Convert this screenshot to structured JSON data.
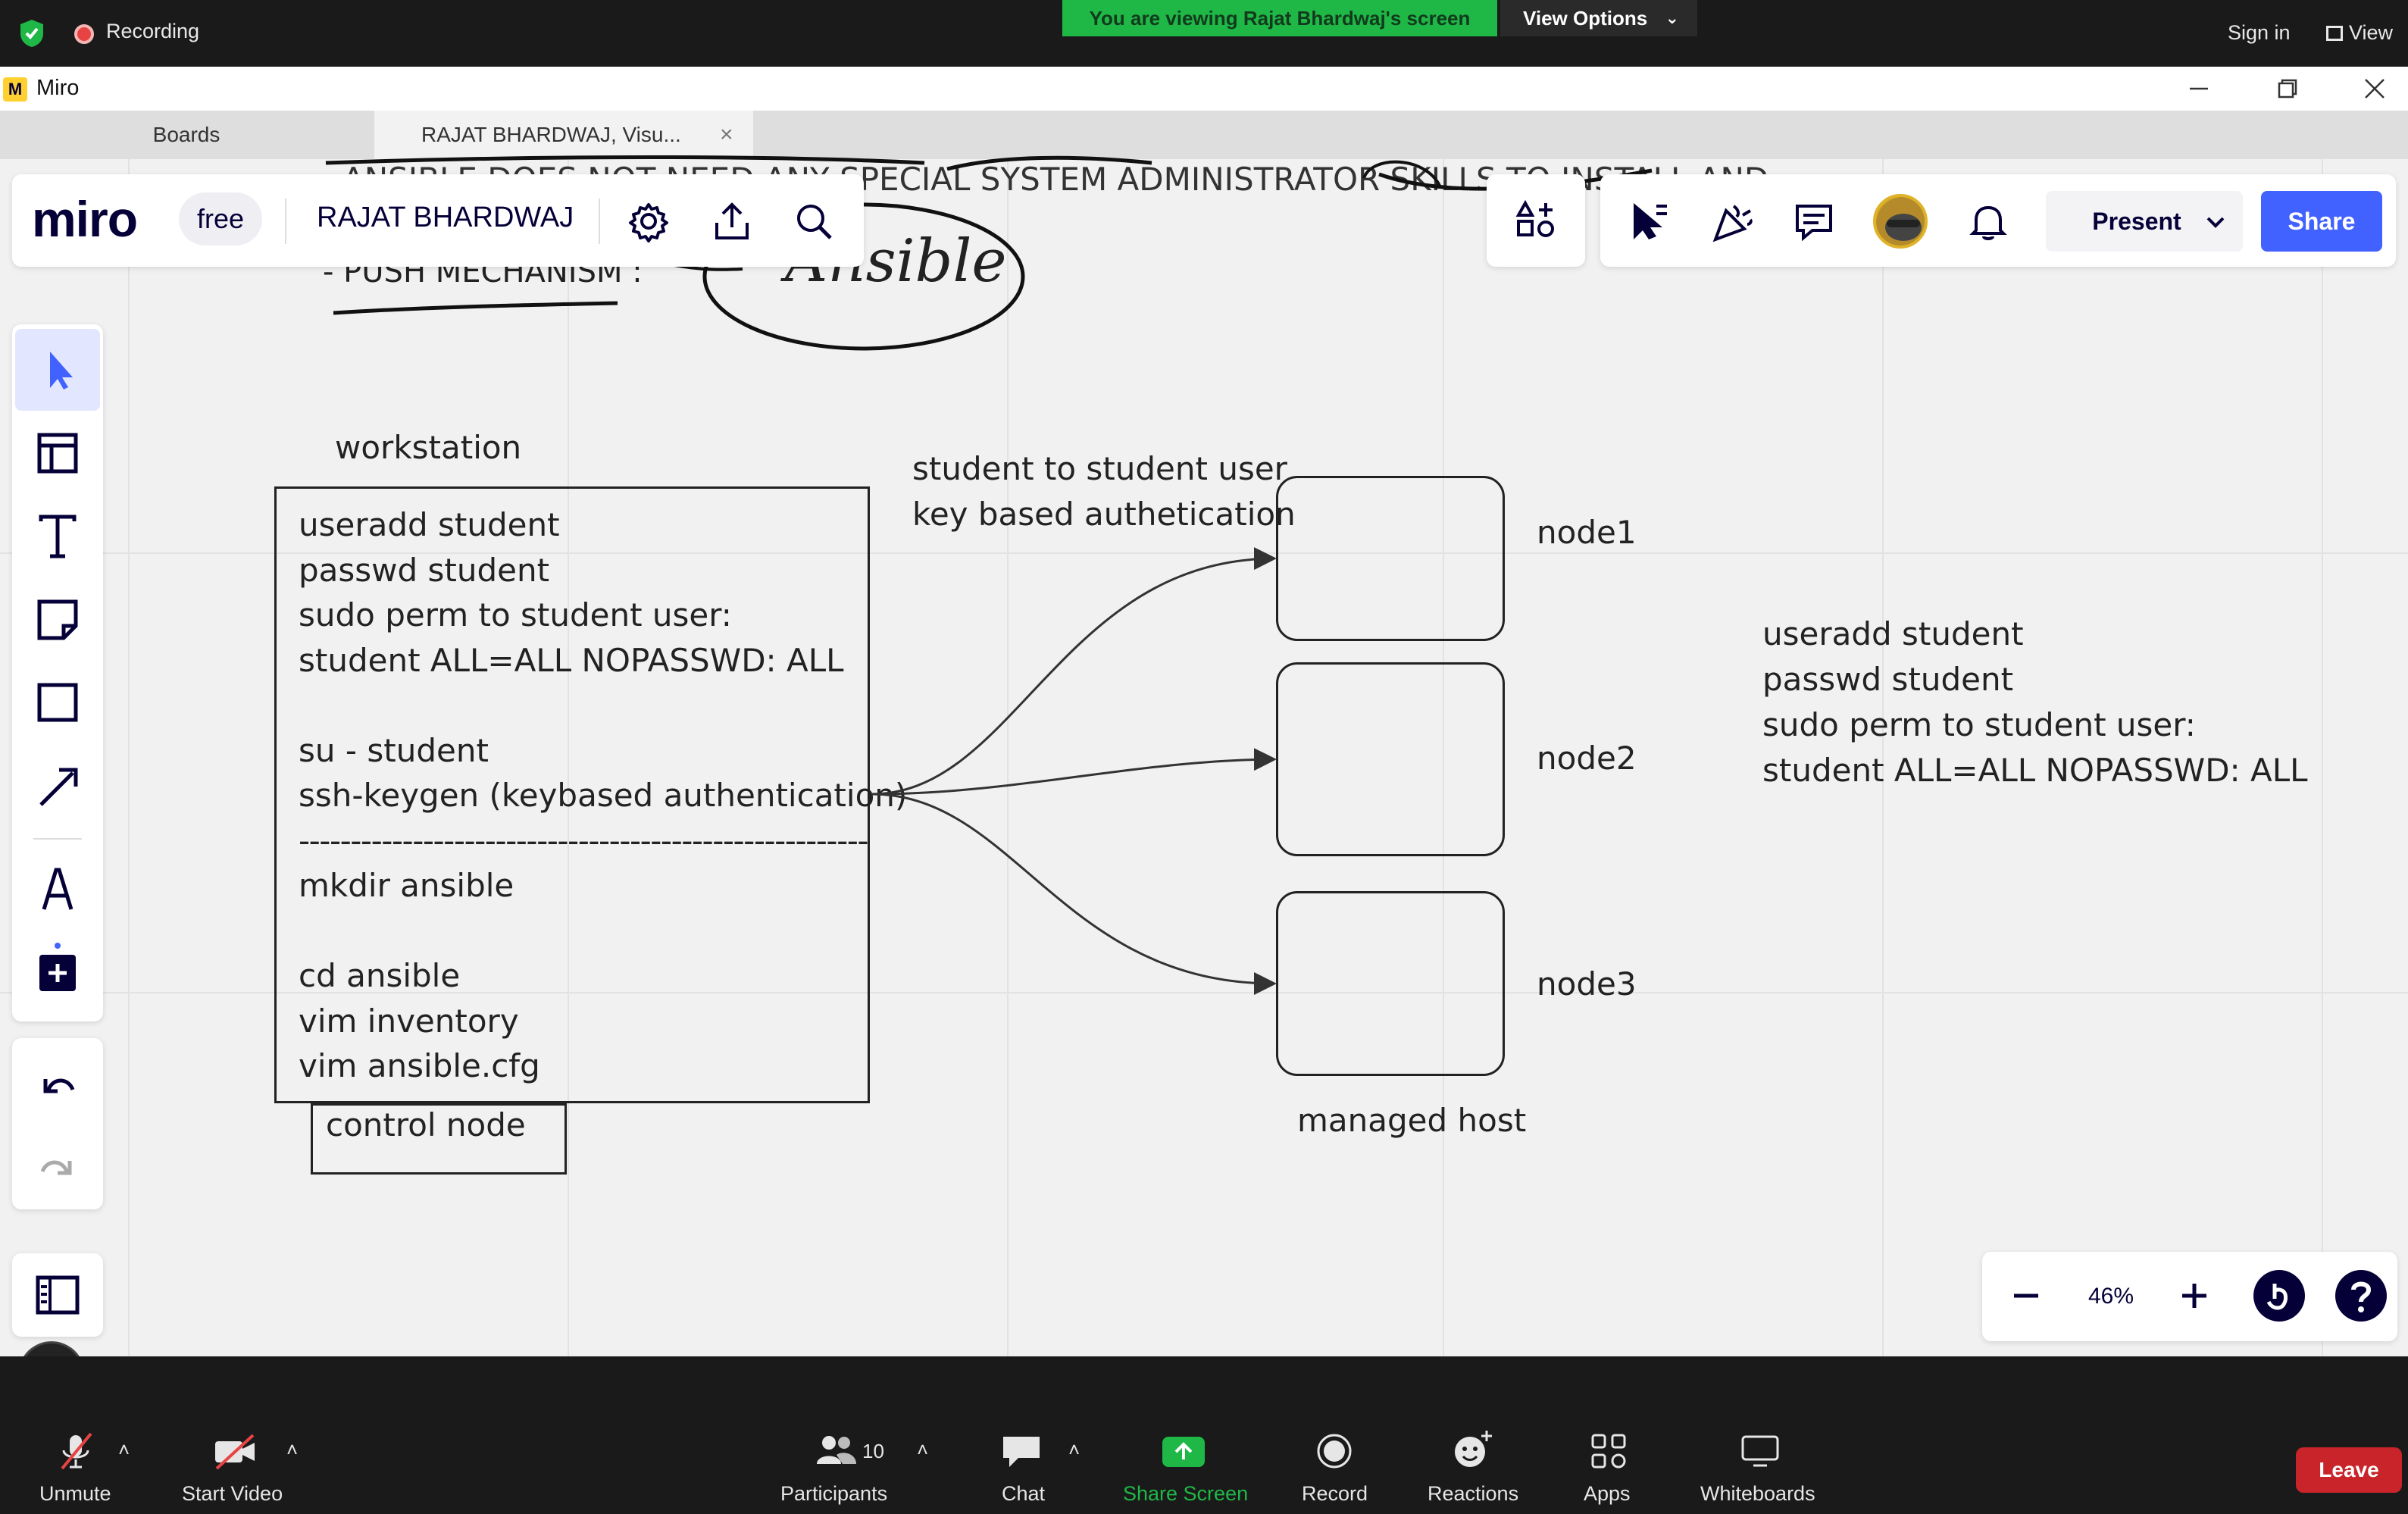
{
  "zoom_top": {
    "recording_label": "Recording",
    "banner_text": "You are viewing Rajat Bhardwaj's screen",
    "view_options_label": "View Options",
    "sign_in_label": "Sign in",
    "view_label": "View"
  },
  "window": {
    "app_name": "Miro"
  },
  "tabs": [
    {
      "label": "Boards"
    },
    {
      "label": "RAJAT BHARDWAJ, Visu..."
    }
  ],
  "miro_toolbar": {
    "logo": "miro",
    "plan_badge": "free",
    "board_name": "RAJAT BHARDWAJ",
    "present_label": "Present",
    "share_label": "Share",
    "zoom_level": "46%"
  },
  "board": {
    "partial_text_top": "ANSIBLE DOES NOT NEED ANY SPECIAL SYSTEM ADMINISTRATOR SKILLS TO INSTALL AND",
    "push_mechanism": "- PUSH MECHANISM :",
    "ansible_handwritten": "Ansible",
    "workstation_label": "workstation",
    "workstation_lines": [
      "useradd student",
      "passwd student",
      "sudo perm to student user:",
      "student ALL=ALL NOPASSWD: ALL",
      "",
      "su - student",
      "ssh-keygen (keybased authentication)",
      "-------------------------------------------------------",
      "mkdir ansible",
      "",
      "cd ansible",
      "vim inventory",
      "vim ansible.cfg"
    ],
    "control_node_label": "control node",
    "arrow_caption_line1": "student to student user",
    "arrow_caption_line2": "key based authetication",
    "nodes": [
      "node1",
      "node2",
      "node3"
    ],
    "managed_host_label": "managed host",
    "right_notes": [
      "useradd student",
      "passwd student",
      "sudo perm to student user:",
      "student ALL=ALL NOPASSWD: ALL"
    ]
  },
  "zoom_bottom": {
    "unmute": "Unmute",
    "start_video": "Start Video",
    "participants": "Participants",
    "participants_count": "10",
    "chat": "Chat",
    "share_screen": "Share Screen",
    "record": "Record",
    "reactions": "Reactions",
    "apps": "Apps",
    "whiteboards": "Whiteboards",
    "leave": "Leave"
  },
  "colors": {
    "zoom_bg": "#1a1a1a",
    "banner_green": "#1fb847",
    "miro_blue": "#4262ff",
    "leave_red": "#c8242a",
    "canvas_bg": "#f1f1f1"
  }
}
